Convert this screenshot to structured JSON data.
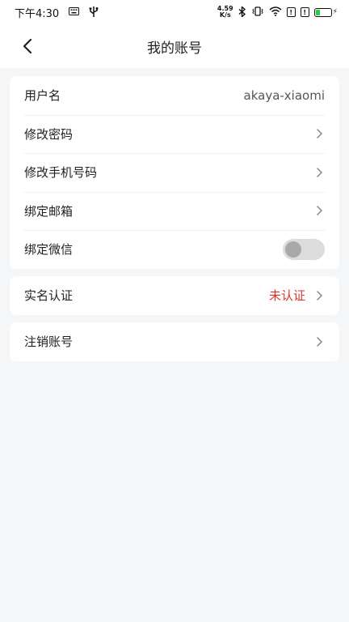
{
  "status_bar": {
    "time": "下午4:30",
    "net_speed_value": "4.59",
    "net_speed_unit": "K/s"
  },
  "header": {
    "title": "我的账号"
  },
  "account_card": {
    "username_label": "用户名",
    "username_value": "akaya-xiaomi",
    "change_password": "修改密码",
    "change_phone": "修改手机号码",
    "bind_email": "绑定邮箱",
    "bind_wechat": "绑定微信",
    "wechat_bound": false
  },
  "verify_card": {
    "label": "实名认证",
    "status": "未认证",
    "status_color": "#e0312b"
  },
  "cancel_card": {
    "label": "注销账号"
  }
}
